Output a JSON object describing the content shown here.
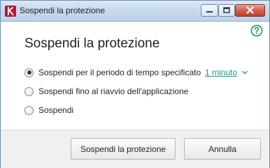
{
  "window": {
    "title": "Sospendi la protezione",
    "logo_icon": "kaspersky-k-logo-icon",
    "controls": [
      "minimize-icon",
      "maximize-icon",
      "close-icon"
    ]
  },
  "help_icon": "help-question-icon",
  "heading": "Sospendi la protezione",
  "options": [
    {
      "label": "Sospendi per il periodo di tempo specificato",
      "checked": true
    },
    {
      "label": "Sospendi fino al riavvio dell'applicazione",
      "checked": false
    },
    {
      "label": "Sospendi",
      "checked": false
    }
  ],
  "duration": {
    "value": "1 minuto",
    "icon": "chevron-down-icon"
  },
  "buttons": {
    "confirm": "Sospendi la protezione",
    "cancel": "Annulla"
  },
  "colors": {
    "accent_link": "#169c82",
    "logo_red": "#c8102e",
    "close_button": "#c2402a",
    "footer_bg": "#f0f0f0"
  }
}
